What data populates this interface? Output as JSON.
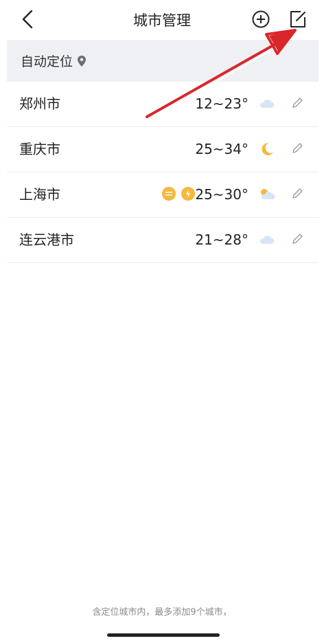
{
  "header": {
    "title": "城市管理"
  },
  "auto_locate": {
    "label": "自动定位"
  },
  "cities": [
    {
      "name": "郑州市",
      "temp": "12~23°",
      "weather_icon": "cloud-icon"
    },
    {
      "name": "重庆市",
      "temp": "25~34°",
      "weather_icon": "moon-icon"
    },
    {
      "name": "上海市",
      "temp": "25~30°",
      "weather_icon": "partly-cloudy-icon"
    },
    {
      "name": "连云港市",
      "temp": "21~28°",
      "weather_icon": "cloud-icon"
    }
  ],
  "footer": {
    "note": "含定位城市内，最多添加9个城市，"
  },
  "colors": {
    "annotation_red": "#d9262b",
    "accent_orange": "#f4b93e",
    "autoloc_bg": "#eef0f3"
  }
}
